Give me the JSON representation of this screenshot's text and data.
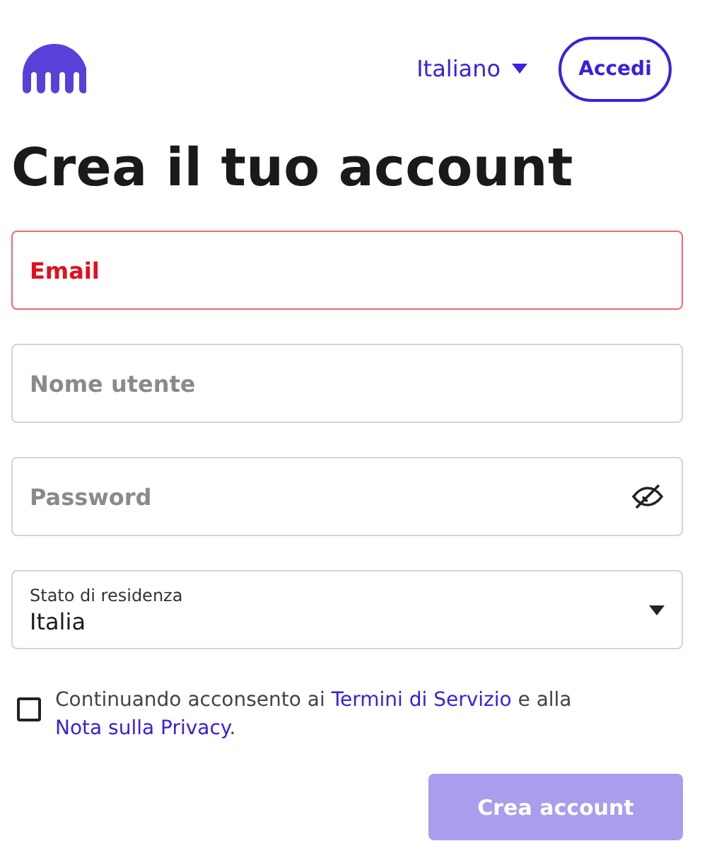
{
  "header": {
    "language": "Italiano",
    "login_button": "Accedi"
  },
  "title": "Crea il tuo account",
  "fields": [
    {
      "kind": "text",
      "placeholder": "Email",
      "error": true
    },
    {
      "kind": "text",
      "placeholder": "Nome utente",
      "error": false
    },
    {
      "kind": "password",
      "placeholder": "Password",
      "error": false
    },
    {
      "kind": "select",
      "label": "Stato di residenza",
      "value": "Italia"
    }
  ],
  "consent": {
    "checked": false,
    "parts": [
      {
        "kind": "text",
        "text": "Continuando acconsento ai "
      },
      {
        "kind": "link",
        "text": "Termini di Servizio"
      },
      {
        "kind": "text",
        "text": " e alla "
      },
      {
        "kind": "link",
        "text": "Nota sulla Privacy"
      },
      {
        "kind": "text",
        "text": "."
      }
    ]
  },
  "submit": {
    "label": "Crea account",
    "disabled": true
  }
}
